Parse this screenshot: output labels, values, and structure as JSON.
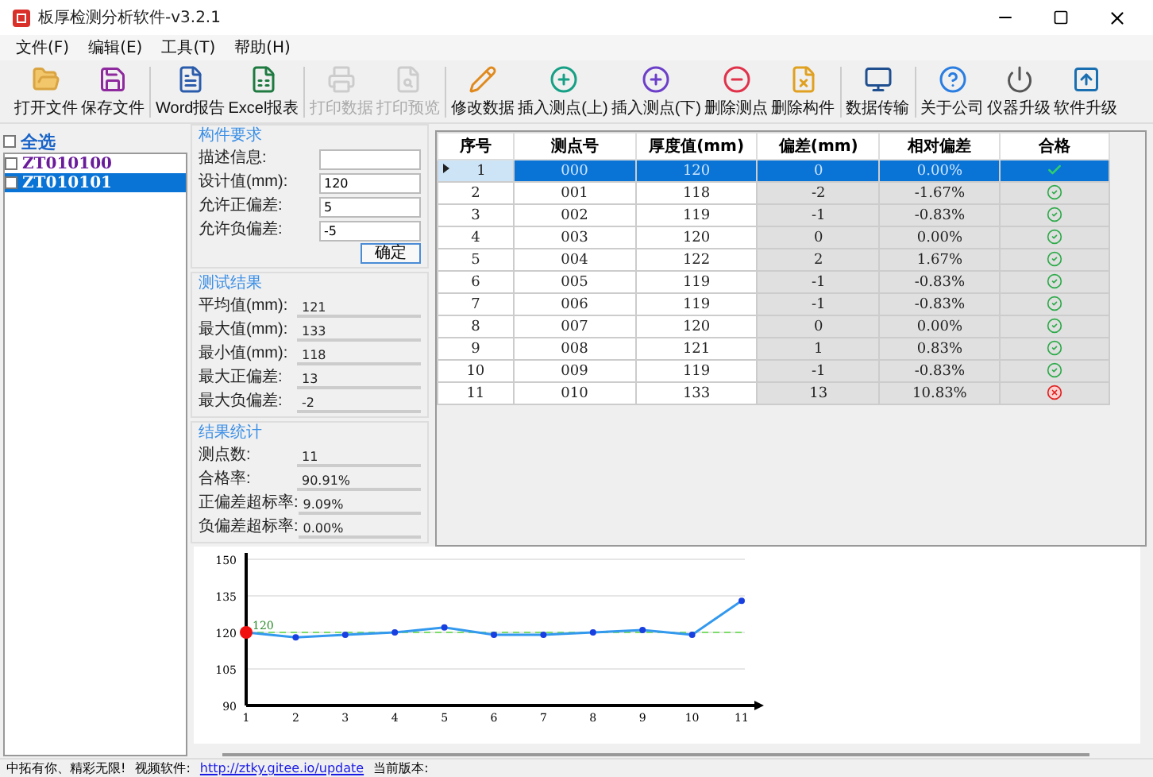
{
  "window": {
    "title": "板厚检测分析软件-v3.2.1"
  },
  "menu": [
    "文件(F)",
    "编辑(E)",
    "工具(T)",
    "帮助(H)"
  ],
  "toolbar": [
    [
      {
        "label": "打开文件",
        "disabled": false
      },
      {
        "label": "保存文件",
        "disabled": false
      }
    ],
    [
      {
        "label": "Word报告",
        "disabled": false
      },
      {
        "label": "Excel报表",
        "disabled": false
      }
    ],
    [
      {
        "label": "打印数据",
        "disabled": true
      },
      {
        "label": "打印预览",
        "disabled": true
      }
    ],
    [
      {
        "label": "修改数据",
        "disabled": false
      },
      {
        "label": "插入测点(上)",
        "disabled": false
      },
      {
        "label": "插入测点(下)",
        "disabled": false
      },
      {
        "label": "删除测点",
        "disabled": false
      },
      {
        "label": "删除构件",
        "disabled": false
      }
    ],
    [
      {
        "label": "数据传输",
        "disabled": false
      }
    ],
    [
      {
        "label": "关于公司",
        "disabled": false
      },
      {
        "label": "仪器升级",
        "disabled": false
      },
      {
        "label": "软件升级",
        "disabled": false
      }
    ]
  ],
  "member_list": {
    "select_all": {
      "label": "全选",
      "checked": false
    },
    "items": [
      {
        "label": "ZT010100",
        "checked": false,
        "selected": false
      },
      {
        "label": "ZT010101",
        "checked": false,
        "selected": true
      }
    ]
  },
  "requirements": {
    "title": "构件要求",
    "fields": [
      {
        "label": "描述信息:"
      },
      {
        "label": "设计值(mm):",
        "value": "120"
      },
      {
        "label": "允许正偏差:",
        "value": "5"
      },
      {
        "label": "允许负偏差:",
        "value": "-5"
      }
    ],
    "button": "确定"
  },
  "test_results": {
    "title": "测试结果",
    "fields": [
      {
        "label": "平均值(mm):",
        "value": "121"
      },
      {
        "label": "最大值(mm):",
        "value": "133"
      },
      {
        "label": "最小值(mm):",
        "value": "118"
      },
      {
        "label": "最大正偏差:",
        "value": "13"
      },
      {
        "label": "最大负偏差:",
        "value": "-2"
      }
    ]
  },
  "statistics": {
    "title": "结果统计",
    "fields": [
      {
        "label": "测点数:",
        "value": "11"
      },
      {
        "label": "合格率:",
        "value": "90.91%"
      },
      {
        "label": "正偏差超标率:",
        "value": "9.09%"
      },
      {
        "label": "负偏差超标率:",
        "value": "0.00%"
      }
    ]
  },
  "table": {
    "columns": [
      "序号",
      "测点号",
      "厚度值(mm)",
      "偏差(mm)",
      "相对偏差",
      "合格"
    ],
    "rows": [
      {
        "index": "1",
        "point": "000",
        "thickness": "120",
        "deviation": "0",
        "relative": "0.00%",
        "pass": true,
        "selected": true
      },
      {
        "index": "2",
        "point": "001",
        "thickness": "118",
        "deviation": "-2",
        "relative": "-1.67%",
        "pass": true,
        "selected": false
      },
      {
        "index": "3",
        "point": "002",
        "thickness": "119",
        "deviation": "-1",
        "relative": "-0.83%",
        "pass": true,
        "selected": false
      },
      {
        "index": "4",
        "point": "003",
        "thickness": "120",
        "deviation": "0",
        "relative": "0.00%",
        "pass": true,
        "selected": false
      },
      {
        "index": "5",
        "point": "004",
        "thickness": "122",
        "deviation": "2",
        "relative": "1.67%",
        "pass": true,
        "selected": false
      },
      {
        "index": "6",
        "point": "005",
        "thickness": "119",
        "deviation": "-1",
        "relative": "-0.83%",
        "pass": true,
        "selected": false
      },
      {
        "index": "7",
        "point": "006",
        "thickness": "119",
        "deviation": "-1",
        "relative": "-0.83%",
        "pass": true,
        "selected": false
      },
      {
        "index": "8",
        "point": "007",
        "thickness": "120",
        "deviation": "0",
        "relative": "0.00%",
        "pass": true,
        "selected": false
      },
      {
        "index": "9",
        "point": "008",
        "thickness": "121",
        "deviation": "1",
        "relative": "0.83%",
        "pass": true,
        "selected": false
      },
      {
        "index": "10",
        "point": "009",
        "thickness": "119",
        "deviation": "-1",
        "relative": "-0.83%",
        "pass": true,
        "selected": false
      },
      {
        "index": "11",
        "point": "010",
        "thickness": "133",
        "deviation": "13",
        "relative": "10.83%",
        "pass": false,
        "selected": false
      }
    ]
  },
  "chart": {
    "chart_data": {
      "type": "line",
      "x": [
        1,
        2,
        3,
        4,
        5,
        6,
        7,
        8,
        9,
        10,
        11
      ],
      "series": [
        {
          "color": "#3399ee",
          "marker": "o",
          "values": [
            120,
            118,
            119,
            120,
            122,
            119,
            119,
            120,
            121,
            119,
            133
          ]
        }
      ],
      "xlim": [
        1,
        11
      ],
      "ylim": [
        90,
        150
      ],
      "yticks": [
        90,
        105,
        120,
        135,
        150
      ],
      "xticks": [
        1,
        2,
        3,
        4,
        5,
        6,
        7,
        8,
        9,
        10,
        11
      ],
      "grid": true,
      "ref_lines": [
        {
          "axis": "y",
          "value": 120,
          "label": "120",
          "color": "#7ddc6a"
        }
      ]
    }
  },
  "status_bar": {
    "slogan": "中拓有你、精彩无限!",
    "video_label": "视频软件:",
    "link": "http://ztky.gitee.io/update",
    "version_label": "当前版本:"
  }
}
